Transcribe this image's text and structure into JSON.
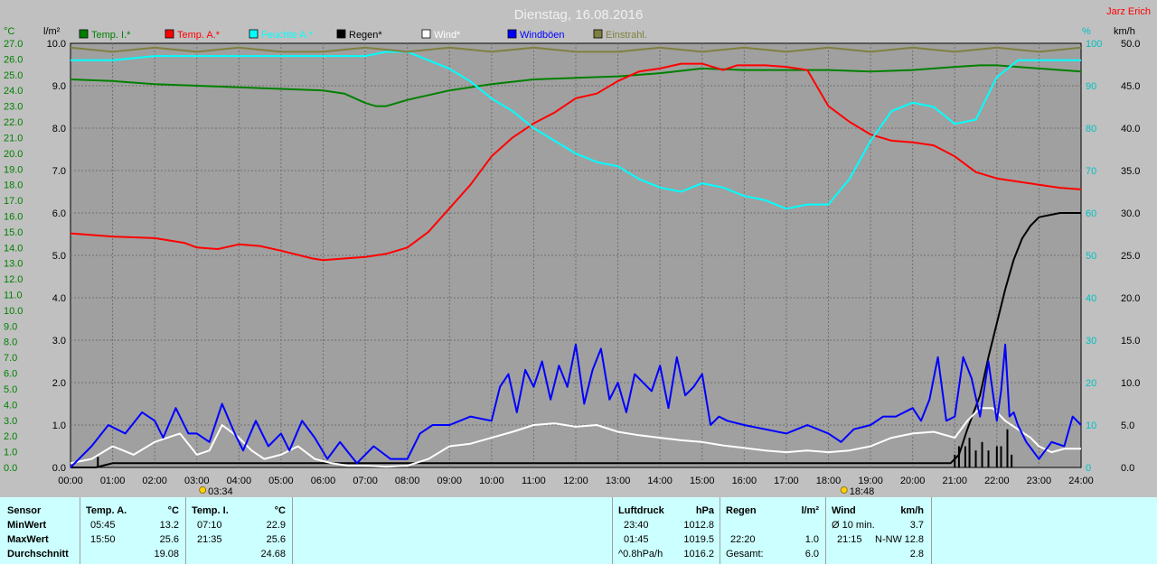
{
  "chart_data": {
    "type": "line",
    "title": "Dienstag, 16.08.2016",
    "corner_label": "Jarz Erich",
    "x_ticks": [
      "00:00",
      "01:00",
      "02:00",
      "03:00",
      "04:00",
      "05:00",
      "06:00",
      "07:00",
      "08:00",
      "09:00",
      "10:00",
      "11:00",
      "12:00",
      "13:00",
      "14:00",
      "15:00",
      "16:00",
      "17:00",
      "18:00",
      "19:00",
      "20:00",
      "21:00",
      "22:00",
      "23:00",
      "24:00"
    ],
    "sunrise": "03:34",
    "sunset": "18:48",
    "axes": {
      "temp": {
        "unit": "°C",
        "min": 0,
        "max": 27,
        "step": 1,
        "color": "#008000"
      },
      "rain": {
        "unit": "l/m²",
        "min": 0,
        "max": 10,
        "step": 1,
        "color": "#000000"
      },
      "humidity": {
        "unit": "%",
        "min": 0,
        "max": 100,
        "step": 10,
        "color": "#00c0c0"
      },
      "wind": {
        "unit": "km/h",
        "min": 0,
        "max": 50,
        "step": 5,
        "color": "#000000"
      }
    },
    "legend": [
      {
        "name": "Temp. I.*",
        "color": "#008000"
      },
      {
        "name": "Temp. A.*",
        "color": "#ff0000"
      },
      {
        "name": "Feuchte A.*",
        "color": "#00ffff"
      },
      {
        "name": "Regen*",
        "color": "#000000"
      },
      {
        "name": "Wind*",
        "color": "#ffffff"
      },
      {
        "name": "Windböen",
        "color": "#0000ff"
      },
      {
        "name": "Einstrahl.",
        "color": "#808040"
      }
    ],
    "series": [
      {
        "name": "Temp. I.*",
        "axis": "temp",
        "color": "#008000",
        "x": [
          0,
          1,
          2,
          3,
          4,
          5,
          6,
          6.5,
          7,
          7.25,
          7.5,
          8,
          9,
          10,
          11,
          12,
          13,
          14,
          15,
          16,
          17,
          18,
          19,
          20,
          21,
          21.6,
          22,
          23,
          24
        ],
        "y": [
          24.7,
          24.6,
          24.4,
          24.3,
          24.2,
          24.1,
          24.0,
          23.8,
          23.2,
          23.0,
          23.0,
          23.4,
          24.0,
          24.4,
          24.7,
          24.8,
          24.9,
          25.1,
          25.4,
          25.3,
          25.3,
          25.3,
          25.2,
          25.3,
          25.5,
          25.6,
          25.6,
          25.4,
          25.2
        ]
      },
      {
        "name": "Temp. A.*",
        "axis": "temp",
        "color": "#ff0000",
        "x": [
          0,
          1,
          2,
          2.7,
          3,
          3.5,
          4,
          4.5,
          5,
          5.75,
          6,
          7,
          7.5,
          8,
          8.5,
          9,
          9.5,
          10,
          10.5,
          11,
          11.5,
          12,
          12.5,
          13,
          13.5,
          14,
          14.5,
          15,
          15.5,
          15.83,
          16,
          16.5,
          17,
          17.5,
          18,
          18.5,
          19,
          19.5,
          20,
          20.5,
          21,
          21.5,
          22,
          22.5,
          23,
          23.5,
          24
        ],
        "y": [
          14.9,
          14.7,
          14.6,
          14.3,
          14.0,
          13.9,
          14.2,
          14.1,
          13.8,
          13.3,
          13.2,
          13.4,
          13.6,
          14.0,
          15.0,
          16.5,
          18.0,
          19.8,
          21.0,
          21.9,
          22.6,
          23.5,
          23.8,
          24.6,
          25.2,
          25.4,
          25.7,
          25.7,
          25.3,
          25.6,
          25.6,
          25.6,
          25.5,
          25.3,
          23.0,
          22.0,
          21.2,
          20.8,
          20.7,
          20.5,
          19.8,
          18.8,
          18.4,
          18.2,
          18.0,
          17.8,
          17.7
        ]
      },
      {
        "name": "Feuchte A.*",
        "axis": "humidity",
        "color": "#00ffff",
        "x": [
          0,
          1,
          2,
          3,
          4,
          5,
          6,
          7,
          7.5,
          8,
          8.5,
          9,
          9.5,
          10,
          10.5,
          11,
          11.5,
          12,
          12.5,
          13,
          13.5,
          14,
          14.5,
          15,
          15.5,
          16,
          16.5,
          17,
          17.5,
          18,
          18.5,
          19,
          19.5,
          20,
          20.5,
          21,
          21.5,
          22,
          22.5,
          23,
          23.5,
          24
        ],
        "y": [
          96,
          96,
          97,
          97,
          97,
          97,
          97,
          97,
          98,
          98,
          96,
          94,
          91,
          87,
          84,
          80,
          77,
          74,
          72,
          71,
          68,
          66,
          65,
          67,
          66,
          64,
          63,
          61,
          62,
          62,
          68,
          77,
          84,
          86,
          85,
          81,
          82,
          92,
          96,
          96,
          96,
          96
        ]
      },
      {
        "name": "Regen*",
        "axis": "rain",
        "color": "#000000",
        "x": [
          0,
          0.6,
          0.8,
          1.0,
          20.9,
          21.1,
          21.3,
          21.6,
          21.8,
          22.0,
          22.2,
          22.4,
          22.6,
          22.8,
          23.0,
          23.5,
          24
        ],
        "y": [
          0,
          0,
          0.05,
          0.1,
          0.1,
          0.3,
          0.9,
          1.7,
          2.6,
          3.4,
          4.2,
          4.9,
          5.4,
          5.7,
          5.9,
          6.0,
          6.0
        ]
      },
      {
        "name": "Wind*",
        "axis": "wind",
        "color": "#ffffff",
        "x": [
          0,
          0.5,
          1.0,
          1.5,
          2.0,
          2.3,
          2.6,
          3.0,
          3.3,
          3.6,
          4.0,
          4.3,
          4.6,
          5.0,
          5.4,
          5.8,
          6.2,
          6.6,
          7.0,
          7.5,
          8.0,
          8.5,
          9.0,
          9.5,
          10.0,
          10.5,
          11.0,
          11.5,
          12.0,
          12.5,
          13.0,
          13.5,
          14.0,
          14.5,
          15.0,
          15.5,
          16.0,
          16.5,
          17.0,
          17.5,
          18.0,
          18.5,
          19.0,
          19.5,
          20.0,
          20.5,
          21.0,
          21.3,
          21.6,
          21.9,
          22.2,
          22.5,
          22.8,
          23.0,
          23.3,
          23.6,
          24.0
        ],
        "y": [
          0.5,
          1.0,
          2.5,
          1.5,
          3.0,
          3.5,
          4.0,
          1.5,
          2.0,
          5.0,
          3.5,
          2.0,
          1.0,
          1.5,
          2.5,
          1.0,
          0.5,
          0.2,
          0.2,
          0.1,
          0.2,
          1.0,
          2.5,
          2.8,
          3.5,
          4.2,
          5.0,
          5.2,
          4.8,
          5.0,
          4.2,
          3.8,
          3.5,
          3.2,
          3.0,
          2.6,
          2.3,
          2.0,
          1.8,
          2.0,
          1.8,
          2.0,
          2.5,
          3.5,
          4.0,
          4.2,
          3.5,
          5.5,
          7.0,
          7.0,
          5.5,
          4.5,
          3.5,
          2.5,
          1.8,
          2.2,
          2.2
        ]
      },
      {
        "name": "Windböen",
        "axis": "wind",
        "color": "#0000ff",
        "x": [
          0,
          0.5,
          0.9,
          1.3,
          1.7,
          2.0,
          2.2,
          2.5,
          2.8,
          3.0,
          3.3,
          3.6,
          3.9,
          4.1,
          4.4,
          4.7,
          5.0,
          5.2,
          5.5,
          5.8,
          6.1,
          6.4,
          6.8,
          7.2,
          7.6,
          8.0,
          8.3,
          8.6,
          9.0,
          9.5,
          10.0,
          10.2,
          10.4,
          10.6,
          10.8,
          11.0,
          11.2,
          11.4,
          11.6,
          11.8,
          12.0,
          12.2,
          12.4,
          12.6,
          12.8,
          13.0,
          13.2,
          13.4,
          13.6,
          13.8,
          14.0,
          14.2,
          14.4,
          14.6,
          14.8,
          15.0,
          15.2,
          15.4,
          15.6,
          16.0,
          16.5,
          17.0,
          17.5,
          18.0,
          18.3,
          18.6,
          19.0,
          19.3,
          19.6,
          20.0,
          20.2,
          20.4,
          20.6,
          20.8,
          21.0,
          21.2,
          21.4,
          21.6,
          21.8,
          22.0,
          22.1,
          22.2,
          22.3,
          22.4,
          22.5,
          22.7,
          23.0,
          23.3,
          23.6,
          23.8,
          24.0
        ],
        "y": [
          0,
          2.5,
          5.0,
          4.0,
          6.5,
          5.5,
          3.5,
          7.0,
          4.0,
          4.0,
          3.0,
          7.5,
          4.0,
          2.0,
          5.5,
          2.5,
          4.0,
          2.0,
          5.5,
          3.5,
          1.0,
          3.0,
          0.5,
          2.5,
          1.0,
          1.0,
          4.0,
          5.0,
          5.0,
          6.0,
          5.5,
          9.5,
          11.0,
          6.5,
          11.5,
          9.5,
          12.5,
          8.0,
          12.0,
          9.5,
          14.5,
          7.5,
          11.5,
          14.0,
          8.0,
          10.0,
          6.5,
          11.0,
          10.0,
          9.0,
          12.0,
          7.0,
          13.0,
          8.5,
          9.5,
          11.0,
          5.0,
          6.0,
          5.5,
          5.0,
          4.5,
          4.0,
          5.0,
          4.0,
          3.0,
          4.5,
          5.0,
          6.0,
          6.0,
          7.0,
          5.5,
          8.0,
          13.0,
          5.5,
          6.0,
          13.0,
          10.5,
          6.0,
          12.5,
          5.5,
          9.0,
          14.5,
          6.0,
          6.5,
          5.0,
          3.0,
          1.0,
          3.0,
          2.5,
          6.0,
          5.0
        ]
      },
      {
        "name": "Einstrahl.",
        "axis": "humidity",
        "color": "#808040",
        "x": [
          0,
          1,
          2,
          3,
          4,
          5,
          6,
          7,
          8,
          9,
          10,
          11,
          12,
          13,
          14,
          15,
          16,
          17,
          18,
          19,
          20,
          21,
          22,
          23,
          24
        ],
        "y": [
          99,
          98,
          99,
          98,
          99,
          98,
          98,
          99,
          98,
          99,
          98,
          99,
          98,
          98,
          99,
          98,
          99,
          98,
          99,
          98,
          99,
          98,
          99,
          98,
          99
        ]
      }
    ],
    "rain_bars": {
      "x": [
        0.65,
        21.0,
        21.1,
        21.25,
        21.35,
        21.5,
        21.65,
        21.8,
        22.0,
        22.1,
        22.25,
        22.35
      ],
      "y": [
        0.25,
        0.3,
        0.5,
        0.5,
        0.7,
        0.4,
        0.6,
        0.4,
        0.5,
        0.5,
        0.9,
        0.3
      ]
    }
  },
  "stats": {
    "sensor_header": "Sensor",
    "row_labels": [
      "MinWert",
      "MaxWert",
      "Durchschnitt"
    ],
    "temp_a": {
      "header": "Temp. A.",
      "unit": "°C",
      "min_time": "05:45",
      "min": "13.2",
      "max_time": "15:50",
      "max": "25.6",
      "avg": "19.08"
    },
    "temp_i": {
      "header": "Temp. I.",
      "unit": "°C",
      "min_time": "07:10",
      "min": "22.9",
      "max_time": "21:35",
      "max": "25.6",
      "avg": "24.68"
    },
    "pressure": {
      "header": "Luftdruck",
      "unit": "hPa",
      "min_time": "23:40",
      "min": "1012.8",
      "max_time": "01:45",
      "max": "1019.5",
      "trend": "^0.8hPa/h",
      "avg": "1016.2"
    },
    "rain": {
      "header": "Regen",
      "unit": "l/m²",
      "max_time": "22:20",
      "max": "1.0",
      "total_label": "Gesamt:",
      "total": "6.0"
    },
    "wind": {
      "header": "Wind",
      "unit": "km/h",
      "avg10_label": "Ø 10 min.",
      "avg10": "3.7",
      "max_time": "21:15",
      "max_dir": "N-NW",
      "max": "12.8",
      "avg": "2.8"
    }
  }
}
